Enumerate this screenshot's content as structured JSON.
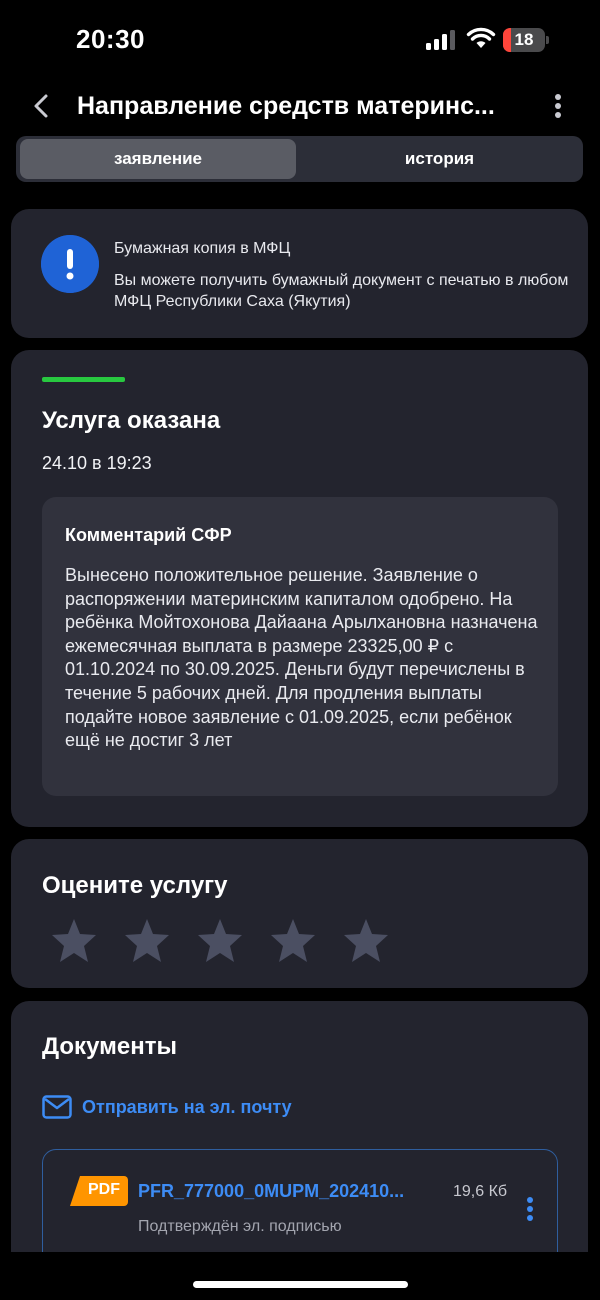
{
  "status_bar": {
    "time": "20:30",
    "battery_level": "18",
    "battery_color": "#ff453a"
  },
  "nav": {
    "title": "Направление средств материнс..."
  },
  "tabs": [
    {
      "label": "заявление",
      "active": true
    },
    {
      "label": "история",
      "active": false
    }
  ],
  "info_card": {
    "title": "Бумажная копия в МФЦ",
    "text": "Вы можете получить бумажный документ с печатью в любом МФЦ Республики Саха (Якутия)",
    "icon": "exclamation-icon",
    "icon_color": "#1f63d6"
  },
  "status_card": {
    "status": "Услуга оказана",
    "status_color": "#28c840",
    "date": "24.10 в 19:23",
    "comment_title": "Комментарий СФР",
    "comment_text": "Вынесено положительное решение. Заявление о распоряжении материнским капиталом одобрено. На ребёнка Мойтохонова Дайаана Арылхановна назначена ежемесячная выплата в размере 23325,00 ₽ с 01.10.2024 по 30.09.2025. Деньги будут перечислены в течение 5 рабочих дней. Для продления выплаты подайте новое заявление с 01.09.2025, если ребёнок ещё не достиг 3 лет"
  },
  "rating": {
    "title": "Оцените услугу",
    "max_stars": 5,
    "selected": 0
  },
  "documents": {
    "title": "Документы",
    "email_label": "Отправить на эл. почту",
    "accent_color": "#3d8cf5",
    "items": [
      {
        "type": "PDF",
        "name": "PFR_777000_0MUPM_202410...",
        "size": "19,6 Кб",
        "subtitle": "Подтверждён эл. подписью"
      }
    ]
  }
}
